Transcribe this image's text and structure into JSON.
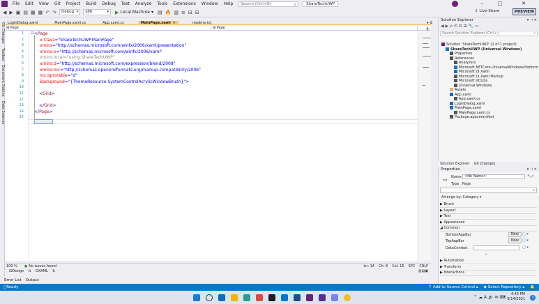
{
  "menu": {
    "items": [
      "File",
      "Edit",
      "View",
      "Git",
      "Project",
      "Build",
      "Debug",
      "Test",
      "Analyze",
      "Tools",
      "Extensions",
      "Window",
      "Help"
    ],
    "search_placeholder": "Search (Ctrl+Q)",
    "solution_name": "ShareTechUWP"
  },
  "toolbar": {
    "config": "Debug",
    "platform": "x86",
    "run_label": "Local Machine",
    "live_share": "Live Share",
    "preview": "PREVIEW"
  },
  "left_strip": [
    "Git Changes",
    "Toolbox",
    "Document Outline",
    "Data Sources"
  ],
  "tabs": [
    {
      "label": "LoginDialog.xaml",
      "active": false
    },
    {
      "label": "MainPage.xaml.cs",
      "active": false
    },
    {
      "label": "App.xaml.cs",
      "active": false
    },
    {
      "label": "MainPage.xaml",
      "active": true
    },
    {
      "label": "readme.txt",
      "active": false
    }
  ],
  "navbar": {
    "left": "Page",
    "right": "Page"
  },
  "code_lines": [
    {
      "n": "1",
      "parts": [
        [
          "<",
          "cblue"
        ],
        [
          "Page",
          "cbrown"
        ]
      ]
    },
    {
      "n": "2",
      "parts": [
        [
          "x:Class",
          "cred"
        ],
        [
          "=\"ShareTechUWP.MainPage\"",
          "cblue"
        ]
      ]
    },
    {
      "n": "3",
      "parts": [
        [
          "xmlns",
          "cred"
        ],
        [
          "=\"http://schemas.microsoft.com/winfx/2006/xaml/presentation\"",
          "cblue"
        ]
      ]
    },
    {
      "n": "4",
      "parts": [
        [
          "xmlns:x",
          "cred"
        ],
        [
          "=\"http://schemas.microsoft.com/winfx/2006/xaml\"",
          "cblue"
        ]
      ]
    },
    {
      "n": "5",
      "parts": [
        [
          "xmlns:local=\"using:ShareTechUWP\"",
          "cgray"
        ]
      ]
    },
    {
      "n": "6",
      "parts": [
        [
          "xmlns:d",
          "cred"
        ],
        [
          "=\"http://schemas.microsoft.com/expression/blend/2008\"",
          "cblue"
        ]
      ]
    },
    {
      "n": "7",
      "parts": [
        [
          "xmlns:mc",
          "cred"
        ],
        [
          "=\"http://schemas.openxmlformats.org/markup-compatibility/2006\"",
          "cblue"
        ]
      ]
    },
    {
      "n": "8",
      "parts": [
        [
          "mc:Ignorable",
          "cred"
        ],
        [
          "=\"d\"",
          "cblue"
        ]
      ]
    },
    {
      "n": "9",
      "parts": [
        [
          "Background",
          "cred"
        ],
        [
          "=\"{ThemeResource SystemControlAcrylicWindowBrush}\"",
          "cblue"
        ],
        [
          ">",
          "cblue"
        ]
      ]
    },
    {
      "n": "10",
      "parts": []
    },
    {
      "n": "11",
      "parts": [
        [
          "<",
          "cblue"
        ],
        [
          "Grid",
          "cbrown"
        ],
        [
          ">",
          "cblue"
        ]
      ]
    },
    {
      "n": "12",
      "parts": []
    },
    {
      "n": "13",
      "parts": [
        [
          "</",
          "cblue"
        ],
        [
          "Grid",
          "cbrown"
        ],
        [
          ">",
          "cblue"
        ]
      ]
    },
    {
      "n": "14",
      "parts": [
        [
          "</",
          "cblue"
        ],
        [
          "Page",
          "cbrown"
        ],
        [
          ">",
          "cblue"
        ]
      ]
    },
    {
      "n": "15",
      "parts": []
    }
  ],
  "status": {
    "zoom": "100 %",
    "issues": "No issues found",
    "position": "Ln: 14",
    "ch": "Ch: 8",
    "col": "Col: 15",
    "spc": "SPC",
    "eol": "CRLF",
    "design_tab": "Design",
    "xaml_tab": "XAML"
  },
  "output_tabs": [
    "Error List",
    "Output"
  ],
  "bottom_status": {
    "ready": "Ready",
    "add_source": "Add to Source Control",
    "select_repo": "Select Repository"
  },
  "solution_explorer": {
    "title": "Solution Explorer",
    "search_placeholder": "Search Solution Explorer (Ctrl+;)",
    "nodes": [
      {
        "label": "Solution 'ShareTechUWP' (1 of 1 project)",
        "indent": 0,
        "color": "#68217a"
      },
      {
        "label": "ShareTechUWP (Universal Windows)",
        "indent": 1,
        "color": "#1e6fc0",
        "bold": true
      },
      {
        "label": "Properties",
        "indent": 2,
        "color": "#555"
      },
      {
        "label": "References",
        "indent": 2,
        "color": "#555"
      },
      {
        "label": "Analyzers",
        "indent": 3,
        "color": "#555"
      },
      {
        "label": "Microsoft.NETCore.UniversalWindowsPlatform",
        "indent": 3,
        "color": "#1e6fc0"
      },
      {
        "label": "Microsoft.UI.Xaml",
        "indent": 3,
        "color": "#1e6fc0"
      },
      {
        "label": "Microsoft.UI.Xaml.Markup",
        "indent": 3,
        "color": "#555"
      },
      {
        "label": "Microsoft.VCLibs",
        "indent": 3,
        "color": "#555"
      },
      {
        "label": "Universal Windows",
        "indent": 3,
        "color": "#555"
      },
      {
        "label": "Assets",
        "indent": 2,
        "color": "#dcb67a"
      },
      {
        "label": "App.xaml",
        "indent": 2,
        "color": "#1e6fc0"
      },
      {
        "label": "App.xaml.cs",
        "indent": 3,
        "color": "#555"
      },
      {
        "label": "LoginDialog.xaml",
        "indent": 2,
        "color": "#1e6fc0"
      },
      {
        "label": "MainPage.xaml",
        "indent": 2,
        "color": "#1e6fc0"
      },
      {
        "label": "MainPage.xaml.cs",
        "indent": 3,
        "color": "#555"
      },
      {
        "label": "Package.appxmanifest",
        "indent": 2,
        "color": "#555"
      }
    ],
    "tab_active": "Solution Explorer",
    "tab_other": "Git Changes"
  },
  "properties": {
    "title": "Properties",
    "name_label": "Name",
    "name_value": "<No Name>",
    "type_label": "Type",
    "type_value": "Page",
    "arrange": "Arrange by: Category",
    "categories": [
      "Brush",
      "Layout",
      "Text",
      "Appearance",
      "Common"
    ],
    "common_props": [
      "BottomAppBar",
      "TopAppBar",
      "DataContext"
    ],
    "new_label": "New",
    "more_categories": [
      "Automation",
      "Transform",
      "Interactions"
    ]
  },
  "clock": {
    "time": "4:42 PM",
    "date": "9/14/2021"
  },
  "colors": {
    "accent": "#007acc",
    "tab_active": "#f5cc84",
    "vs_purple": "#68217a"
  }
}
